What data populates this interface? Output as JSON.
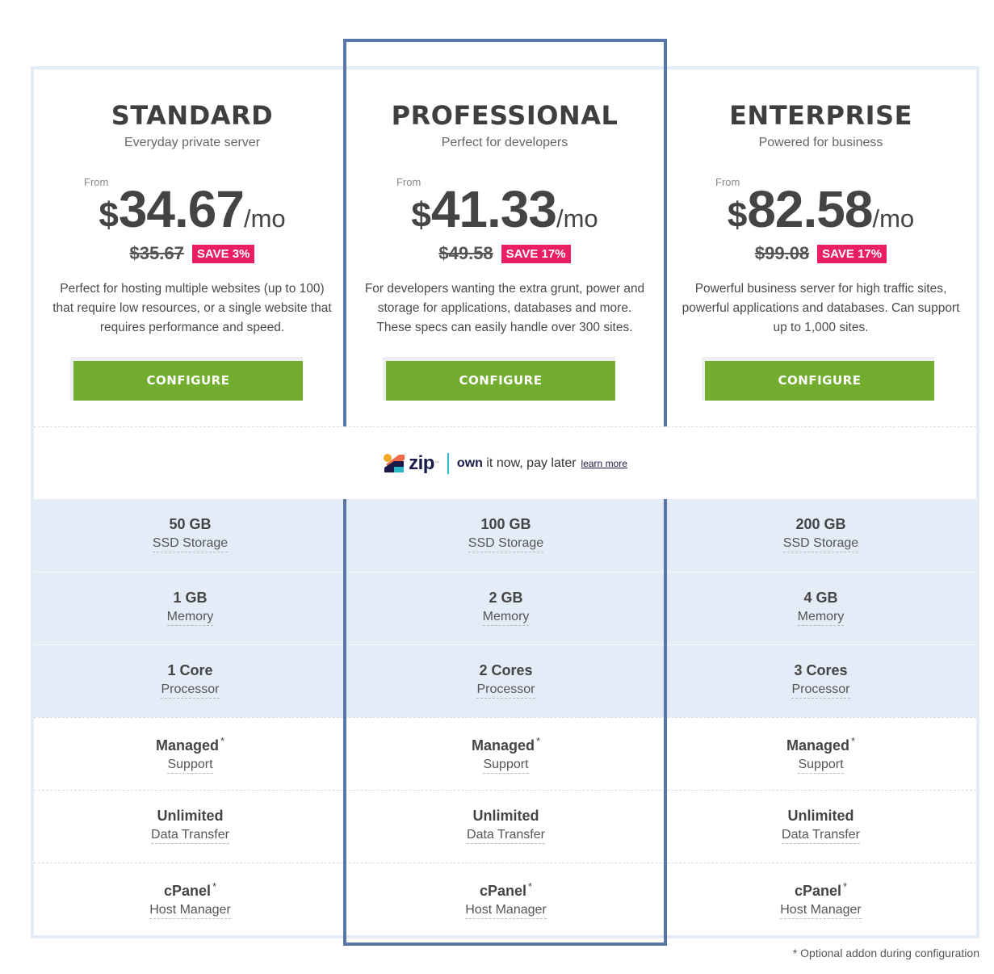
{
  "plans": [
    {
      "name": "STANDARD",
      "tagline": "Everyday private server",
      "from_label": "From",
      "currency": "$",
      "price": "34.67",
      "per": "/mo",
      "old_price": "$35.67",
      "save": "SAVE 3%",
      "description": "Perfect for hosting multiple websites (up to 100) that require low resources, or a single website that requires performance and speed.",
      "button": "CONFIGURE"
    },
    {
      "name": "PROFESSIONAL",
      "tagline": "Perfect for developers",
      "from_label": "From",
      "currency": "$",
      "price": "41.33",
      "per": "/mo",
      "old_price": "$49.58",
      "save": "SAVE 17%",
      "description": "For developers wanting the extra grunt, power and storage for applications, databases and more. These specs can easily handle over 300 sites.",
      "button": "CONFIGURE",
      "highlighted": true
    },
    {
      "name": "ENTERPRISE",
      "tagline": "Powered for business",
      "from_label": "From",
      "currency": "$",
      "price": "82.58",
      "per": "/mo",
      "old_price": "$99.08",
      "save": "SAVE 17%",
      "description": "Powerful business server for high traffic sites, powerful applications and databases. Can support up to 1,000 sites.",
      "button": "CONFIGURE"
    }
  ],
  "zip": {
    "brand": "zip",
    "tagline_bold": "own",
    "tagline_rest": " it now, pay later",
    "learn_more": "learn more",
    "colors": {
      "orange": "#f5a623",
      "coral": "#f26a4b",
      "navy": "#1a1a4a",
      "teal": "#29b6c6"
    }
  },
  "features": [
    {
      "label": "SSD Storage",
      "values": [
        "50 GB",
        "100 GB",
        "200 GB"
      ],
      "shaded": true,
      "addon": false
    },
    {
      "label": "Memory",
      "values": [
        "1 GB",
        "2 GB",
        "4 GB"
      ],
      "shaded": true,
      "addon": false
    },
    {
      "label": "Processor",
      "values": [
        "1 Core",
        "2 Cores",
        "3 Cores"
      ],
      "shaded": true,
      "addon": false
    },
    {
      "label": "Support",
      "values": [
        "Managed",
        "Managed",
        "Managed"
      ],
      "shaded": false,
      "addon": true
    },
    {
      "label": "Data Transfer",
      "values": [
        "Unlimited",
        "Unlimited",
        "Unlimited"
      ],
      "shaded": false,
      "addon": false
    },
    {
      "label": "Host Manager",
      "values": [
        "cPanel",
        "cPanel",
        "cPanel"
      ],
      "shaded": false,
      "addon": true
    }
  ],
  "addon_marker": "*",
  "footnote": "* Optional addon during configuration",
  "colors": {
    "accent_border": "#5876a6",
    "button_green": "#72ad30",
    "save_pink": "#e91e63",
    "row_shade": "#e4ecf7"
  }
}
